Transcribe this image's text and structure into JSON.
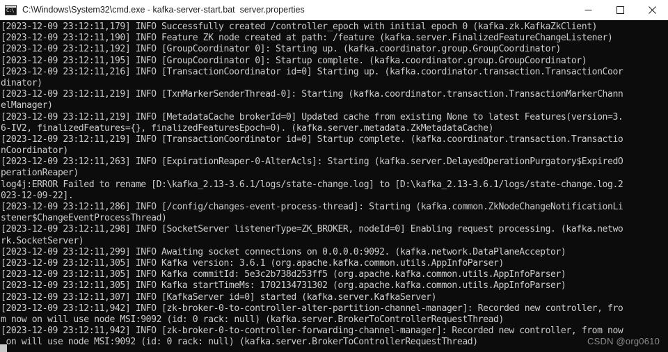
{
  "window": {
    "title": "C:\\Windows\\System32\\cmd.exe - kafka-server-start.bat  server.properties",
    "icon": "cmd-console-icon",
    "icon_glyph": "C:\\",
    "controls": {
      "minimize": "minimize-button",
      "maximize": "maximize-button",
      "close": "close-button"
    },
    "colors": {
      "titlebar_background": "#ffffff",
      "titlebar_text": "#1b1b1b",
      "console_background": "#0c0c0c",
      "console_text": "#cccccc",
      "watermark_text": "#8a8a8a"
    }
  },
  "console": {
    "lines": [
      "[2023-12-09 23:12:11,179] INFO Successfully created /controller_epoch with initial epoch 0 (kafka.zk.KafkaZkClient)",
      "[2023-12-09 23:12:11,190] INFO Feature ZK node created at path: /feature (kafka.server.FinalizedFeatureChangeListener)",
      "[2023-12-09 23:12:11,192] INFO [GroupCoordinator 0]: Starting up. (kafka.coordinator.group.GroupCoordinator)",
      "[2023-12-09 23:12:11,195] INFO [GroupCoordinator 0]: Startup complete. (kafka.coordinator.group.GroupCoordinator)",
      "[2023-12-09 23:12:11,216] INFO [TransactionCoordinator id=0] Starting up. (kafka.coordinator.transaction.TransactionCoor",
      "dinator)",
      "[2023-12-09 23:12:11,219] INFO [TxnMarkerSenderThread-0]: Starting (kafka.coordinator.transaction.TransactionMarkerChann",
      "elManager)",
      "[2023-12-09 23:12:11,219] INFO [MetadataCache brokerId=0] Updated cache from existing None to latest Features(version=3.",
      "6-IV2, finalizedFeatures={}, finalizedFeaturesEpoch=0). (kafka.server.metadata.ZkMetadataCache)",
      "[2023-12-09 23:12:11,219] INFO [TransactionCoordinator id=0] Startup complete. (kafka.coordinator.transaction.Transactio",
      "nCoordinator)",
      "[2023-12-09 23:12:11,263] INFO [ExpirationReaper-0-AlterAcls]: Starting (kafka.server.DelayedOperationPurgatory$ExpiredO",
      "perationReaper)",
      "log4j:ERROR Failed to rename [D:\\kafka_2.13-3.6.1/logs/state-change.log] to [D:\\kafka_2.13-3.6.1/logs/state-change.log.2",
      "023-12-09-22].",
      "[2023-12-09 23:12:11,286] INFO [/config/changes-event-process-thread]: Starting (kafka.common.ZkNodeChangeNotificationLi",
      "stener$ChangeEventProcessThread)",
      "[2023-12-09 23:12:11,298] INFO [SocketServer listenerType=ZK_BROKER, nodeId=0] Enabling request processing. (kafka.netwo",
      "rk.SocketServer)",
      "[2023-12-09 23:12:11,299] INFO Awaiting socket connections on 0.0.0.0:9092. (kafka.network.DataPlaneAcceptor)",
      "[2023-12-09 23:12:11,305] INFO Kafka version: 3.6.1 (org.apache.kafka.common.utils.AppInfoParser)",
      "[2023-12-09 23:12:11,305] INFO Kafka commitId: 5e3c2b738d253ff5 (org.apache.kafka.common.utils.AppInfoParser)",
      "[2023-12-09 23:12:11,305] INFO Kafka startTimeMs: 1702134731302 (org.apache.kafka.common.utils.AppInfoParser)",
      "[2023-12-09 23:12:11,307] INFO [KafkaServer id=0] started (kafka.server.KafkaServer)",
      "[2023-12-09 23:12:11,942] INFO [zk-broker-0-to-controller-alter-partition-channel-manager]: Recorded new controller, fro",
      "m now on will use node MSI:9092 (id: 0 rack: null) (kafka.server.BrokerToControllerRequestThread)",
      "[2023-12-09 23:12:11,942] INFO [zk-broker-0-to-controller-forwarding-channel-manager]: Recorded new controller, from now",
      " on will use node MSI:9092 (id: 0 rack: null) (kafka.server.BrokerToControllerRequestThread)"
    ]
  },
  "watermark": {
    "text": "CSDN @org0610"
  }
}
